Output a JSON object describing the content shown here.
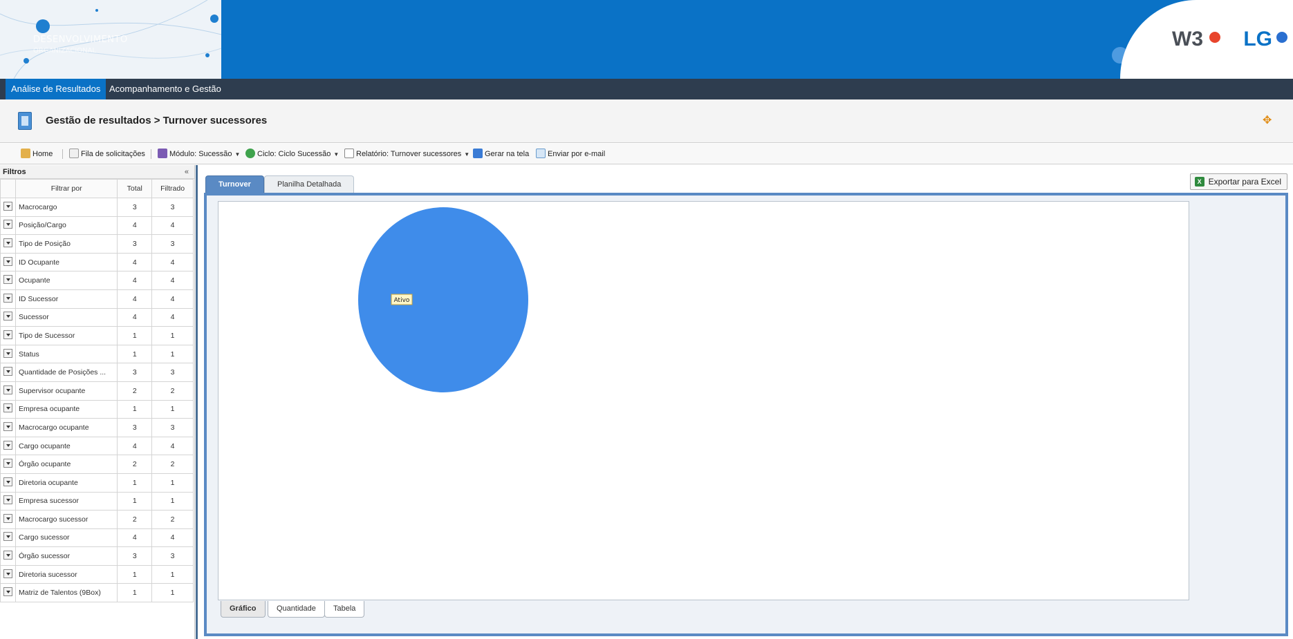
{
  "banner": {
    "title": "DESENVOLVIMENTO",
    "subtitle": "ORGANIZACIONAL",
    "logos": [
      "W3",
      "LG"
    ]
  },
  "menu": {
    "items": [
      {
        "label": "Análise de Resultados",
        "active": true
      },
      {
        "label": "Acompanhamento e Gestão",
        "active": false
      }
    ]
  },
  "page": {
    "breadcrumb": "Gestão de resultados > Turnover sucessores"
  },
  "toolbar": {
    "home": "Home",
    "queue": "Fila de solicitações",
    "module": "Módulo: Sucessão",
    "cycle": "Ciclo: Ciclo Sucessão",
    "report": "Relatório: Turnover sucessores",
    "generate": "Gerar na tela",
    "email": "Enviar por e-mail"
  },
  "filters": {
    "title": "Filtros",
    "collapse": "«",
    "headers": {
      "filter_by": "Filtrar por",
      "total": "Total",
      "filtered": "Filtrado"
    },
    "rows": [
      {
        "label": "Macrocargo",
        "total": "3",
        "filtered": "3"
      },
      {
        "label": "Posição/Cargo",
        "total": "4",
        "filtered": "4"
      },
      {
        "label": "Tipo de Posição",
        "total": "3",
        "filtered": "3"
      },
      {
        "label": "ID Ocupante",
        "total": "4",
        "filtered": "4"
      },
      {
        "label": "Ocupante",
        "total": "4",
        "filtered": "4"
      },
      {
        "label": "ID Sucessor",
        "total": "4",
        "filtered": "4"
      },
      {
        "label": "Sucessor",
        "total": "4",
        "filtered": "4"
      },
      {
        "label": "Tipo de Sucessor",
        "total": "1",
        "filtered": "1"
      },
      {
        "label": "Status",
        "total": "1",
        "filtered": "1"
      },
      {
        "label": "Quantidade de Posições ...",
        "total": "3",
        "filtered": "3"
      },
      {
        "label": "Supervisor ocupante",
        "total": "2",
        "filtered": "2"
      },
      {
        "label": "Empresa ocupante",
        "total": "1",
        "filtered": "1"
      },
      {
        "label": "Macrocargo ocupante",
        "total": "3",
        "filtered": "3"
      },
      {
        "label": "Cargo ocupante",
        "total": "4",
        "filtered": "4"
      },
      {
        "label": "Órgão ocupante",
        "total": "2",
        "filtered": "2"
      },
      {
        "label": "Diretoria ocupante",
        "total": "1",
        "filtered": "1"
      },
      {
        "label": "Empresa sucessor",
        "total": "1",
        "filtered": "1"
      },
      {
        "label": "Macrocargo sucessor",
        "total": "2",
        "filtered": "2"
      },
      {
        "label": "Cargo sucessor",
        "total": "4",
        "filtered": "4"
      },
      {
        "label": "Órgão sucessor",
        "total": "3",
        "filtered": "3"
      },
      {
        "label": "Diretoria sucessor",
        "total": "1",
        "filtered": "1"
      },
      {
        "label": "Matriz de Talentos (9Box)",
        "total": "1",
        "filtered": "1"
      }
    ]
  },
  "tabs": [
    {
      "label": "Turnover",
      "active": true
    },
    {
      "label": "Planilha Detalhada",
      "active": false
    }
  ],
  "export_label": "Exportar para Excel",
  "subtabs": [
    {
      "label": "Gráfico",
      "active": true
    },
    {
      "label": "Quantidade",
      "active": false
    },
    {
      "label": "Tabela",
      "active": false
    }
  ],
  "chart_data": {
    "type": "pie",
    "categories": [
      "Ativo"
    ],
    "values": [
      1
    ],
    "colors": [
      "#3f8cea"
    ],
    "title": ""
  }
}
